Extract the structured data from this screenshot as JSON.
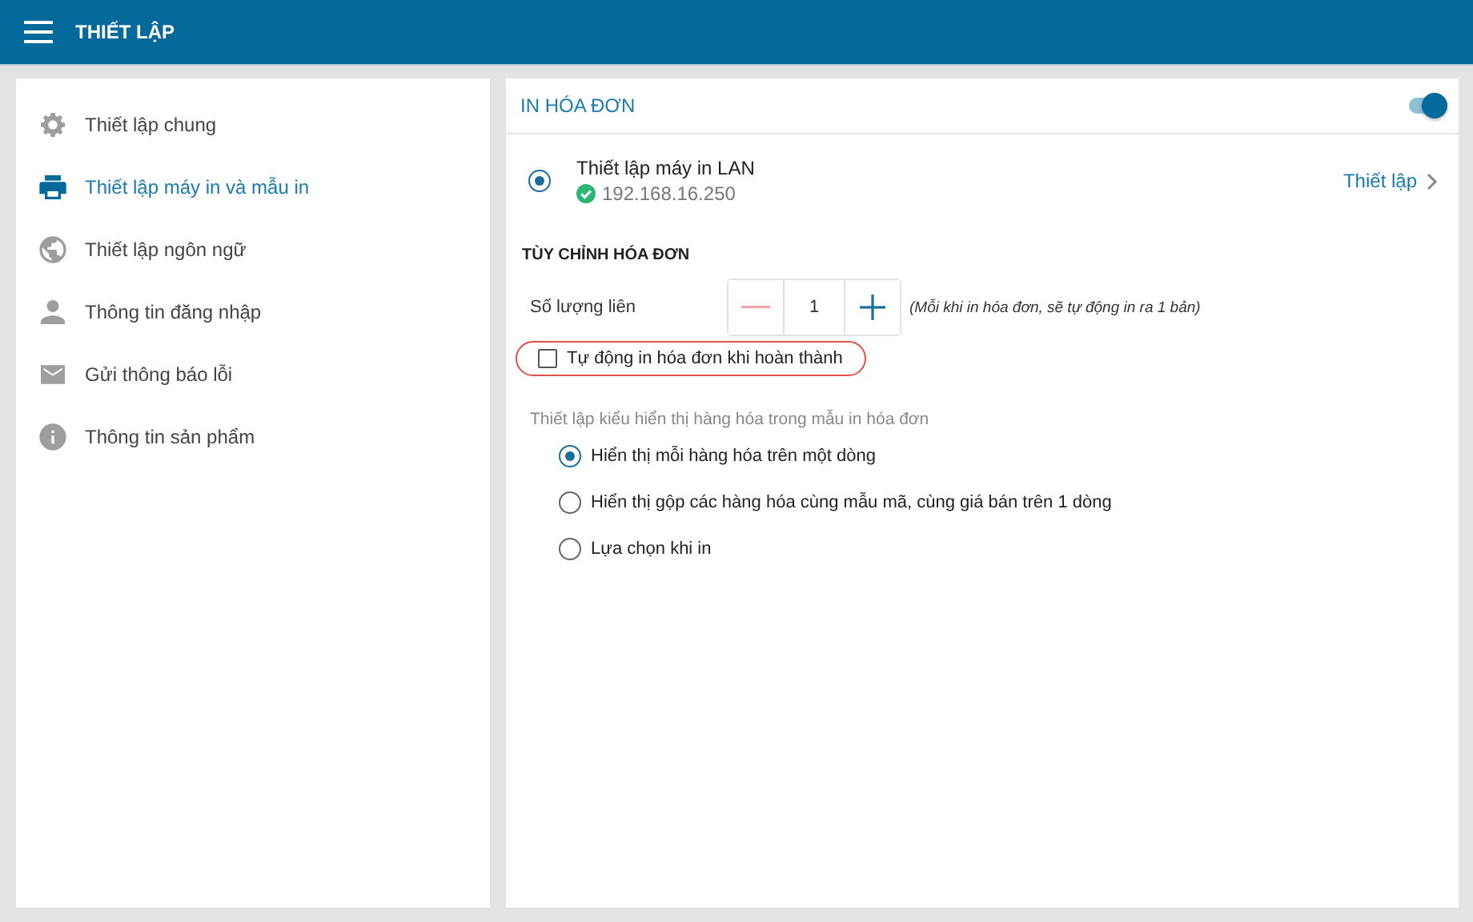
{
  "app_bar": {
    "title": "THIẾT LẬP"
  },
  "sidebar": {
    "items": [
      {
        "label": "Thiết lập chung",
        "selected": false
      },
      {
        "label": "Thiết lập máy in và mẫu in",
        "selected": true
      },
      {
        "label": "Thiết lập ngôn ngữ",
        "selected": false
      },
      {
        "label": "Thông tin đăng nhập",
        "selected": false
      },
      {
        "label": "Gửi thông báo lỗi",
        "selected": false
      },
      {
        "label": "Thông tin sản phẩm",
        "selected": false
      }
    ]
  },
  "panel": {
    "title": "IN HÓA ĐƠN",
    "enabled": true,
    "printer": {
      "name": "Thiết lập máy in LAN",
      "address": "192.168.16.250",
      "connected": true,
      "selected": true,
      "action": "Thiết lập"
    },
    "section_title": "TÙY CHỈNH HÓA ĐƠN",
    "copies": {
      "label": "Số lượng liên",
      "value": "1",
      "decrement_disabled": true,
      "hint": "(Mỗi khi in hóa đơn, sẽ tự động in ra 1 bản)"
    },
    "auto_print": {
      "label": "Tự động in hóa đơn khi hoàn thành",
      "checked": false,
      "highlighted": true
    },
    "display_label": "Thiết lập kiểu hiển thị hàng hóa trong mẫu in hóa đơn",
    "display_options": [
      {
        "label": "Hiển thị mỗi hàng hóa trên một dòng",
        "selected": true
      },
      {
        "label": "Hiển thị gộp các hàng hóa cùng mẫu mã, cùng giá bán trên 1 dòng",
        "selected": false
      },
      {
        "label": "Lựa chọn khi in",
        "selected": false
      }
    ]
  }
}
